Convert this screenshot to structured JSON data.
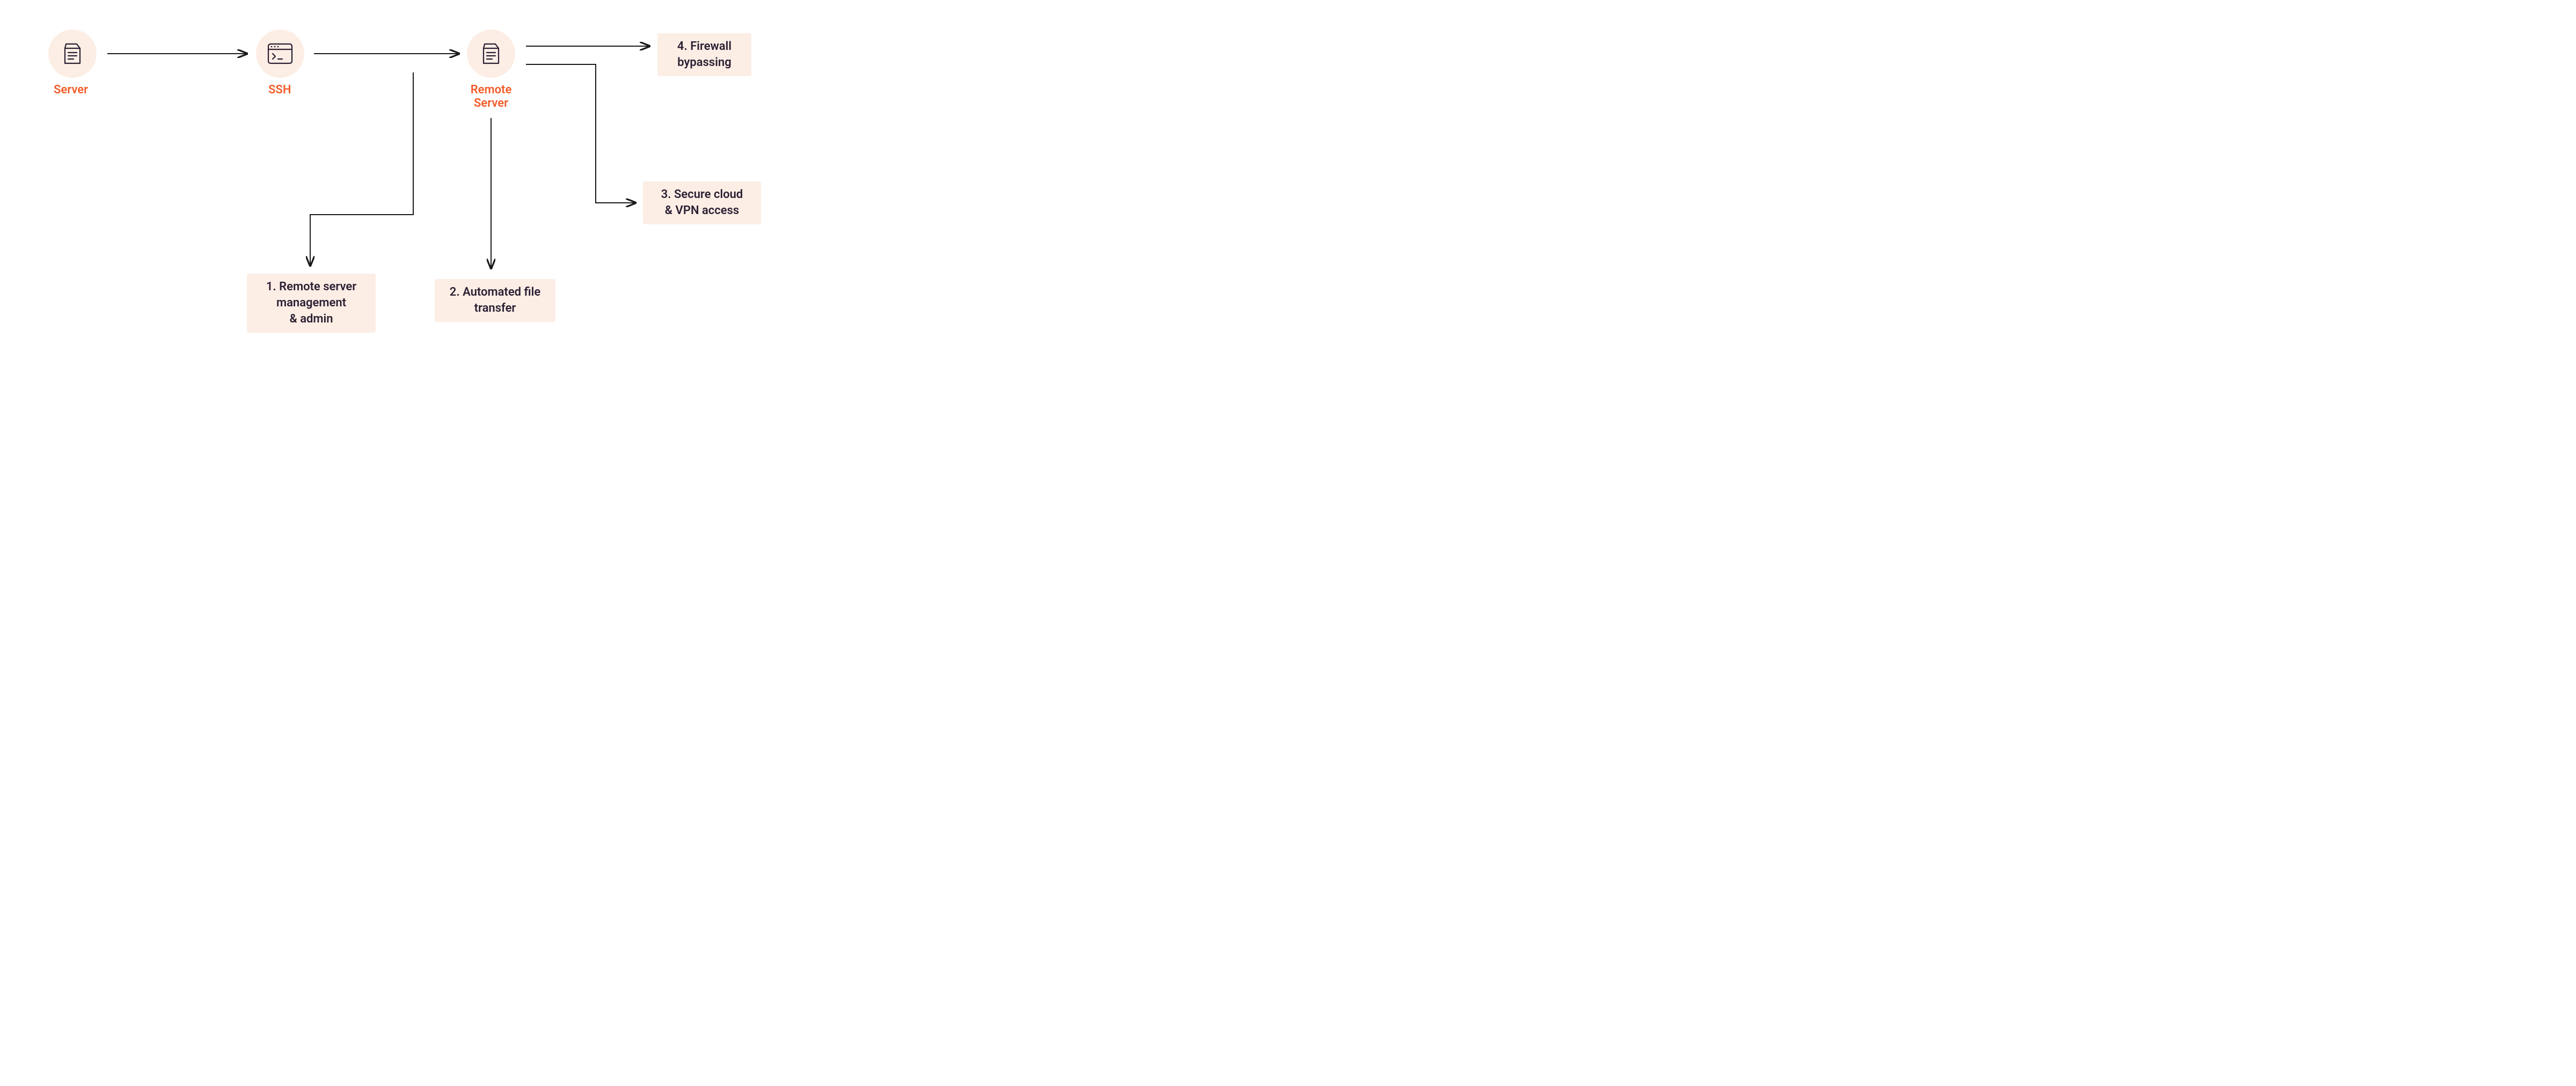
{
  "nodes": {
    "server": {
      "label": "Server"
    },
    "ssh": {
      "label": "SSH"
    },
    "remote_server": {
      "label": "Remote\nServer"
    }
  },
  "use_cases": {
    "u1": "1.  Remote server\nmanagement\n& admin",
    "u2": "2.  Automated file\ntransfer",
    "u3": "3.  Secure cloud\n& VPN access",
    "u4": "4.  Firewall\nbypassing"
  },
  "colors": {
    "accent": "#F25C2A",
    "bg_light": "#FCEEE5",
    "text_dark": "#2B1F33",
    "line": "#1A1A1A"
  }
}
